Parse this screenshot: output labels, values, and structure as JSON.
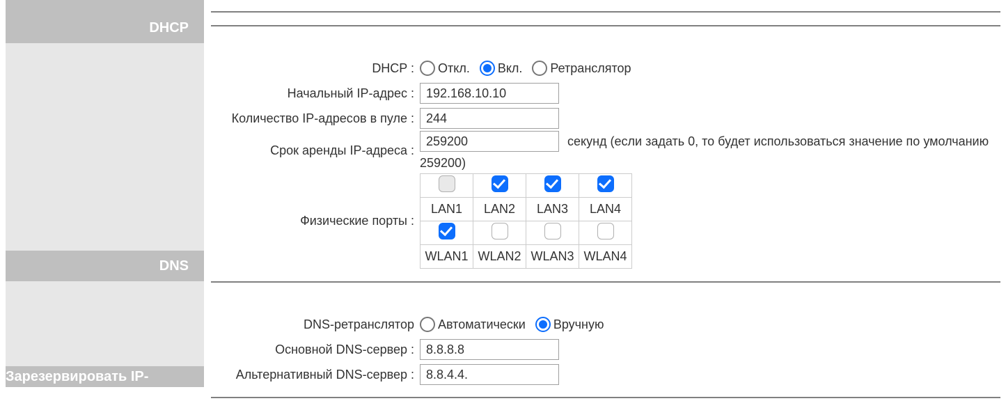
{
  "sidebar": {
    "dhcp": "DHCP",
    "dns": "DNS",
    "reserve": "Зарезервировать IP-адрес"
  },
  "dhcp": {
    "label": "DHCP :",
    "radios": {
      "off": "Откл.",
      "on": "Вкл.",
      "relay": "Ретранслятор"
    },
    "start_ip_label": "Начальный IP-адрес :",
    "start_ip": "192.168.10.10",
    "pool_label": "Количество IP-адресов в пуле :",
    "pool": "244",
    "lease_label": "Срок аренды IP-адреса :",
    "lease": "259200",
    "lease_note1": "секунд (если задать 0, то будет использоваться значение по умолчанию",
    "lease_note2": "259200)",
    "ports_label": "Физические порты :",
    "ports_row1": [
      "LAN1",
      "LAN2",
      "LAN3",
      "LAN4"
    ],
    "ports_row2": [
      "WLAN1",
      "WLAN2",
      "WLAN3",
      "WLAN4"
    ]
  },
  "dns": {
    "relay_label": "DNS-ретранслятор",
    "radios": {
      "auto": "Автоматически",
      "manual": "Вручную"
    },
    "primary_label": "Основной DNS-сервер :",
    "primary": "8.8.8.8",
    "alt_label": "Альтернативный DNS-сервер :",
    "alt": "8.8.4.4."
  }
}
